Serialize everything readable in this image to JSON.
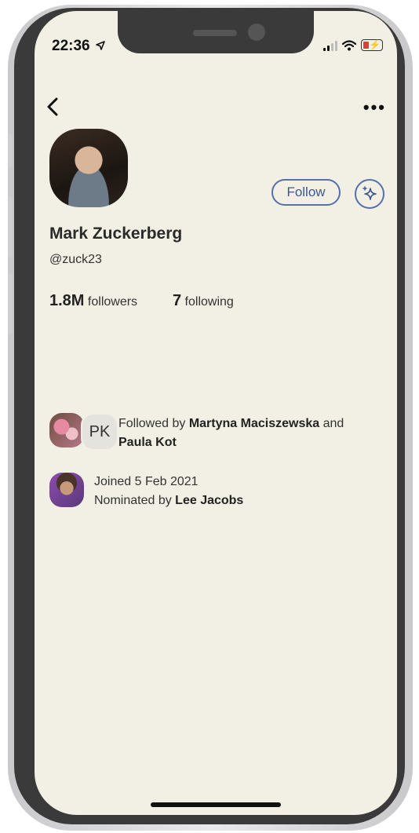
{
  "status_bar": {
    "time": "22:36",
    "location_icon": "location-arrow-icon",
    "signal_icon": "signal-icon",
    "wifi_icon": "wifi-icon",
    "battery_icon": "battery-charging-icon"
  },
  "nav": {
    "back_icon": "chevron-left-icon",
    "more_label": "•••"
  },
  "profile": {
    "name": "Mark Zuckerberg",
    "handle": "@zuck23",
    "follow_label": "Follow",
    "sparkle_icon": "sparkle-icon",
    "followers_count": "1.8M",
    "followers_label": "followers",
    "following_count": "7",
    "following_label": "following"
  },
  "followed_by": {
    "mutual_initials": "PK",
    "prefix": "Followed by",
    "first_name": "Martyna Maciszewska",
    "connector": "and",
    "second_name": "Paula Kot"
  },
  "joined": {
    "joined_text": "Joined 5 Feb 2021",
    "nominated_prefix": "Nominated by",
    "nominator": "Lee Jacobs"
  },
  "colors": {
    "background": "#f2efe4",
    "accent": "#5770a8",
    "frame": "#3a3a3a"
  }
}
